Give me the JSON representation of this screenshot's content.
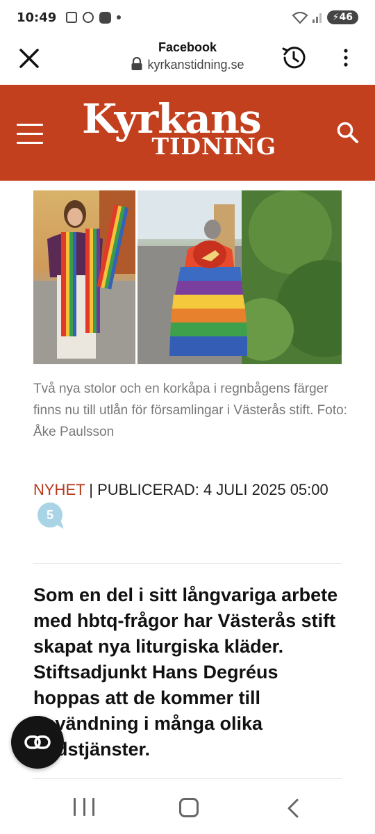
{
  "status_bar": {
    "time": "10:49",
    "battery": "46"
  },
  "browser": {
    "title": "Facebook",
    "url": "kyrkanstidning.se"
  },
  "site": {
    "logo_line1": "Kyrkans",
    "logo_line2": "TIDNING",
    "brand_color": "#c3401e"
  },
  "article": {
    "photo_caption": "Två nya stolor och en korkåpa i regnbågens färger finns nu till utlån för församlingar i Västerås stift. Foto: Åke Paulsson",
    "category": "NYHET",
    "published_prefix": "| PUBLICERAD: 4 JULI 2025 05:00",
    "comment_count": "5",
    "lead": "Som en del i sitt långvariga arbete med hbtq-frågor har Västerås stift skapat nya liturgiska kläder. Stiftsadjunkt Hans Degréus hoppas att de kommer till användning i många olika gudstjänster."
  },
  "icons": {
    "close": "close-icon",
    "lock": "lock-icon",
    "history": "history-icon",
    "more": "more-vert-icon",
    "menu": "hamburger-menu-icon",
    "search": "search-icon",
    "float": "link-icon",
    "nav_recents": "recents-icon",
    "nav_home": "home-icon",
    "nav_back": "back-icon"
  }
}
